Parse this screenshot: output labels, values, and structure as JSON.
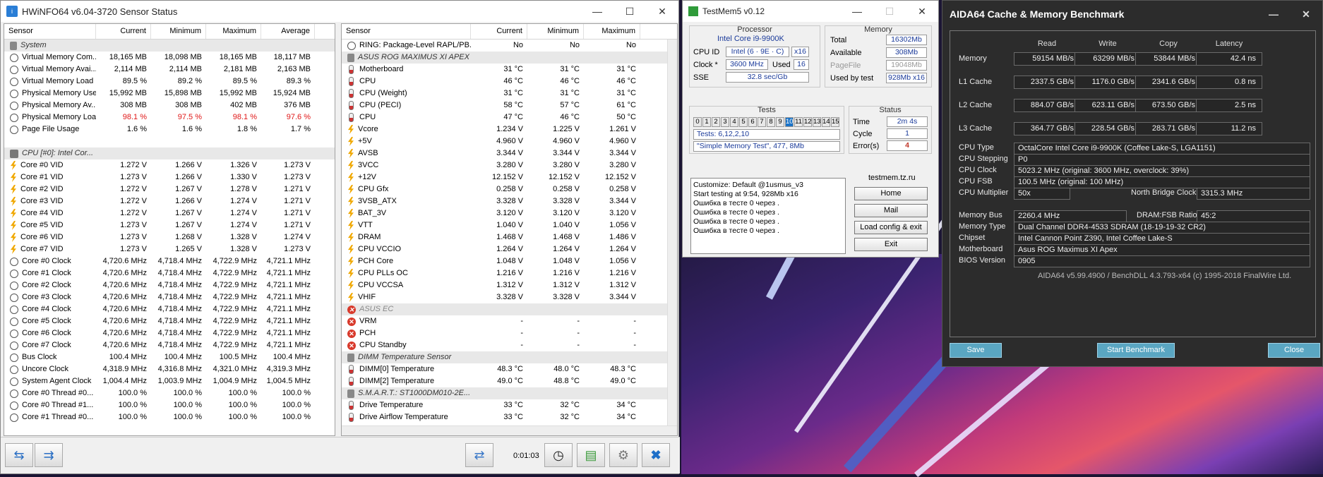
{
  "hwinfo": {
    "title": "HWiNFO64 v6.04-3720 Sensor Status",
    "left_headers": [
      "Sensor",
      "Current",
      "Minimum",
      "Maximum",
      "Average"
    ],
    "right_headers": [
      "Sensor",
      "Current",
      "Minimum",
      "Maximum"
    ],
    "left_rows": [
      {
        "t": "g",
        "n": "System"
      },
      {
        "t": "c",
        "n": "Virtual Memory Com...",
        "v": [
          "18,165 MB",
          "18,098 MB",
          "18,165 MB",
          "18,117 MB"
        ]
      },
      {
        "t": "c",
        "n": "Virtual Memory Avai...",
        "v": [
          "2,114 MB",
          "2,114 MB",
          "2,181 MB",
          "2,163 MB"
        ]
      },
      {
        "t": "c",
        "n": "Virtual Memory Load",
        "v": [
          "89.5 %",
          "89.2 %",
          "89.5 %",
          "89.3 %"
        ]
      },
      {
        "t": "c",
        "n": "Physical Memory Used",
        "v": [
          "15,992 MB",
          "15,898 MB",
          "15,992 MB",
          "15,924 MB"
        ]
      },
      {
        "t": "c",
        "n": "Physical Memory Av...",
        "v": [
          "308 MB",
          "308 MB",
          "402 MB",
          "376 MB"
        ]
      },
      {
        "t": "c",
        "n": "Physical Memory Load",
        "v": [
          "98.1 %",
          "97.5 %",
          "98.1 %",
          "97.6 %"
        ],
        "red": true
      },
      {
        "t": "c",
        "n": "Page File Usage",
        "v": [
          "1.6 %",
          "1.6 %",
          "1.8 %",
          "1.7 %"
        ]
      },
      {
        "t": "e"
      },
      {
        "t": "gc",
        "n": "CPU [#0]: Intel Cor..."
      },
      {
        "t": "b",
        "n": "Core #0 VID",
        "v": [
          "1.272 V",
          "1.266 V",
          "1.326 V",
          "1.273 V"
        ]
      },
      {
        "t": "b",
        "n": "Core #1 VID",
        "v": [
          "1.273 V",
          "1.266 V",
          "1.330 V",
          "1.273 V"
        ]
      },
      {
        "t": "b",
        "n": "Core #2 VID",
        "v": [
          "1.272 V",
          "1.267 V",
          "1.278 V",
          "1.271 V"
        ]
      },
      {
        "t": "b",
        "n": "Core #3 VID",
        "v": [
          "1.272 V",
          "1.266 V",
          "1.274 V",
          "1.271 V"
        ]
      },
      {
        "t": "b",
        "n": "Core #4 VID",
        "v": [
          "1.272 V",
          "1.267 V",
          "1.274 V",
          "1.271 V"
        ]
      },
      {
        "t": "b",
        "n": "Core #5 VID",
        "v": [
          "1.273 V",
          "1.267 V",
          "1.274 V",
          "1.271 V"
        ]
      },
      {
        "t": "b",
        "n": "Core #6 VID",
        "v": [
          "1.273 V",
          "1.268 V",
          "1.328 V",
          "1.274 V"
        ]
      },
      {
        "t": "b",
        "n": "Core #7 VID",
        "v": [
          "1.273 V",
          "1.265 V",
          "1.328 V",
          "1.273 V"
        ]
      },
      {
        "t": "c",
        "n": "Core #0 Clock",
        "v": [
          "4,720.6 MHz",
          "4,718.4 MHz",
          "4,722.9 MHz",
          "4,721.1 MHz"
        ]
      },
      {
        "t": "c",
        "n": "Core #1 Clock",
        "v": [
          "4,720.6 MHz",
          "4,718.4 MHz",
          "4,722.9 MHz",
          "4,721.1 MHz"
        ]
      },
      {
        "t": "c",
        "n": "Core #2 Clock",
        "v": [
          "4,720.6 MHz",
          "4,718.4 MHz",
          "4,722.9 MHz",
          "4,721.1 MHz"
        ]
      },
      {
        "t": "c",
        "n": "Core #3 Clock",
        "v": [
          "4,720.6 MHz",
          "4,718.4 MHz",
          "4,722.9 MHz",
          "4,721.1 MHz"
        ]
      },
      {
        "t": "c",
        "n": "Core #4 Clock",
        "v": [
          "4,720.6 MHz",
          "4,718.4 MHz",
          "4,722.9 MHz",
          "4,721.1 MHz"
        ]
      },
      {
        "t": "c",
        "n": "Core #5 Clock",
        "v": [
          "4,720.6 MHz",
          "4,718.4 MHz",
          "4,722.9 MHz",
          "4,721.1 MHz"
        ]
      },
      {
        "t": "c",
        "n": "Core #6 Clock",
        "v": [
          "4,720.6 MHz",
          "4,718.4 MHz",
          "4,722.9 MHz",
          "4,721.1 MHz"
        ]
      },
      {
        "t": "c",
        "n": "Core #7 Clock",
        "v": [
          "4,720.6 MHz",
          "4,718.4 MHz",
          "4,722.9 MHz",
          "4,721.1 MHz"
        ]
      },
      {
        "t": "c",
        "n": "Bus Clock",
        "v": [
          "100.4 MHz",
          "100.4 MHz",
          "100.5 MHz",
          "100.4 MHz"
        ]
      },
      {
        "t": "c",
        "n": "Uncore Clock",
        "v": [
          "4,318.9 MHz",
          "4,316.8 MHz",
          "4,321.0 MHz",
          "4,319.3 MHz"
        ]
      },
      {
        "t": "c",
        "n": "System Agent Clock",
        "v": [
          "1,004.4 MHz",
          "1,003.9 MHz",
          "1,004.9 MHz",
          "1,004.5 MHz"
        ]
      },
      {
        "t": "c",
        "n": "Core #0 Thread #0...",
        "v": [
          "100.0 %",
          "100.0 %",
          "100.0 %",
          "100.0 %"
        ]
      },
      {
        "t": "c",
        "n": "Core #0 Thread #1...",
        "v": [
          "100.0 %",
          "100.0 %",
          "100.0 %",
          "100.0 %"
        ]
      },
      {
        "t": "c",
        "n": "Core #1 Thread #0...",
        "v": [
          "100.0 %",
          "100.0 %",
          "100.0 %",
          "100.0 %"
        ]
      }
    ],
    "right_rows": [
      {
        "t": "c",
        "n": "RING: Package-Level RAPL/PB...",
        "v": [
          "No",
          "No",
          "No"
        ]
      },
      {
        "t": "g",
        "n": "ASUS ROG MAXIMUS XI APEX (..."
      },
      {
        "t": "tp",
        "n": "Motherboard",
        "v": [
          "31 °C",
          "31 °C",
          "31 °C"
        ]
      },
      {
        "t": "tp",
        "n": "CPU",
        "v": [
          "46 °C",
          "46 °C",
          "46 °C"
        ]
      },
      {
        "t": "tp",
        "n": "CPU (Weight)",
        "v": [
          "31 °C",
          "31 °C",
          "31 °C"
        ]
      },
      {
        "t": "tp",
        "n": "CPU (PECI)",
        "v": [
          "58 °C",
          "57 °C",
          "61 °C"
        ]
      },
      {
        "t": "tp",
        "n": "CPU",
        "v": [
          "47 °C",
          "46 °C",
          "50 °C"
        ]
      },
      {
        "t": "b",
        "n": "Vcore",
        "v": [
          "1.234 V",
          "1.225 V",
          "1.261 V"
        ]
      },
      {
        "t": "b",
        "n": "+5V",
        "v": [
          "4.960 V",
          "4.960 V",
          "4.960 V"
        ]
      },
      {
        "t": "b",
        "n": "AVSB",
        "v": [
          "3.344 V",
          "3.344 V",
          "3.344 V"
        ]
      },
      {
        "t": "b",
        "n": "3VCC",
        "v": [
          "3.280 V",
          "3.280 V",
          "3.280 V"
        ]
      },
      {
        "t": "b",
        "n": "+12V",
        "v": [
          "12.152 V",
          "12.152 V",
          "12.152 V"
        ]
      },
      {
        "t": "b",
        "n": "CPU Gfx",
        "v": [
          "0.258 V",
          "0.258 V",
          "0.258 V"
        ]
      },
      {
        "t": "b",
        "n": "3VSB_ATX",
        "v": [
          "3.328 V",
          "3.328 V",
          "3.344 V"
        ]
      },
      {
        "t": "b",
        "n": "BAT_3V",
        "v": [
          "3.120 V",
          "3.120 V",
          "3.120 V"
        ]
      },
      {
        "t": "b",
        "n": "VTT",
        "v": [
          "1.040 V",
          "1.040 V",
          "1.056 V"
        ]
      },
      {
        "t": "b",
        "n": "DRAM",
        "v": [
          "1.468 V",
          "1.468 V",
          "1.486 V"
        ]
      },
      {
        "t": "b",
        "n": "CPU VCCIO",
        "v": [
          "1.264 V",
          "1.264 V",
          "1.264 V"
        ]
      },
      {
        "t": "b",
        "n": "PCH Core",
        "v": [
          "1.048 V",
          "1.048 V",
          "1.056 V"
        ]
      },
      {
        "t": "b",
        "n": "CPU PLLs OC",
        "v": [
          "1.216 V",
          "1.216 V",
          "1.216 V"
        ]
      },
      {
        "t": "b",
        "n": "CPU VCCSA",
        "v": [
          "1.312 V",
          "1.312 V",
          "1.312 V"
        ]
      },
      {
        "t": "b",
        "n": "VHIF",
        "v": [
          "3.328 V",
          "3.328 V",
          "3.344 V"
        ]
      },
      {
        "t": "gx",
        "n": "ASUS EC"
      },
      {
        "t": "x",
        "n": "VRM",
        "v": [
          "-",
          "-",
          "-"
        ]
      },
      {
        "t": "x",
        "n": "PCH",
        "v": [
          "-",
          "-",
          "-"
        ]
      },
      {
        "t": "x",
        "n": "CPU Standby",
        "v": [
          "-",
          "-",
          "-"
        ]
      },
      {
        "t": "g",
        "n": "DIMM Temperature Sensor"
      },
      {
        "t": "tp",
        "n": "DIMM[0] Temperature",
        "v": [
          "48.3 °C",
          "48.0 °C",
          "48.3 °C"
        ]
      },
      {
        "t": "tp",
        "n": "DIMM[2] Temperature",
        "v": [
          "49.0 °C",
          "48.8 °C",
          "49.0 °C"
        ]
      },
      {
        "t": "g",
        "n": "S.M.A.R.T.: ST1000DM010-2E..."
      },
      {
        "t": "tp",
        "n": "Drive Temperature",
        "v": [
          "33 °C",
          "32 °C",
          "34 °C"
        ]
      },
      {
        "t": "tp",
        "n": "Drive Airflow Temperature",
        "v": [
          "33 °C",
          "32 °C",
          "34 °C"
        ]
      }
    ],
    "timer": "0:01:03"
  },
  "testmem": {
    "title": "TestMem5 v0.12",
    "processor_label": "Processor",
    "cpu_name": "Intel Core i9-9900K",
    "cpu_id_label": "CPU ID",
    "cpu_id": "Intel  (6 · 9E · C)",
    "cpu_threads": "x16",
    "clock_label": "Clock *",
    "clock": "3600 MHz",
    "used_label": "Used",
    "used": "16",
    "sse_label": "SSE",
    "sse": "32.8 sec/Gb",
    "memory_label": "Memory",
    "total_label": "Total",
    "total": "16302Mb",
    "available_label": "Available",
    "available": "308Mb",
    "pagefile_label": "PageFile",
    "pagefile": "19048Mb",
    "usedbytest_label": "Used by test",
    "usedbytest": "928Mb x16",
    "tests_label": "Tests",
    "test_cells": [
      "0",
      "1",
      "2",
      "3",
      "4",
      "5",
      "6",
      "7",
      "8",
      "9",
      "10",
      "11",
      "12",
      "13",
      "14",
      "15"
    ],
    "tests_line": "Tests: 6,12,2,10",
    "current_test": "\"Simple Memory Test\", 477, 8Mb",
    "status_label": "Status",
    "time_label": "Time",
    "time": "2m 4s",
    "cycle_label": "Cycle",
    "cycle": "1",
    "errors_label": "Error(s)",
    "errors": "4",
    "log": [
      "Customize: Default @1usmus_v3",
      "Start testing at 9:54, 928Mb x16",
      "Ошибка в тесте 0 через .",
      "Ошибка в тесте 0 через .",
      "Ошибка в тесте 0 через .",
      "Ошибка в тесте 0 через ."
    ],
    "site": "testmem.tz.ru",
    "btn_home": "Home",
    "btn_mail": "Mail",
    "btn_load": "Load config & exit",
    "btn_exit": "Exit"
  },
  "aida": {
    "title": "AIDA64 Cache & Memory Benchmark",
    "headers": [
      "Read",
      "Write",
      "Copy",
      "Latency"
    ],
    "rows": [
      {
        "label": "Memory",
        "v": [
          "59154 MB/s",
          "63299 MB/s",
          "53844 MB/s",
          "42.4 ns"
        ]
      },
      {
        "label": "L1 Cache",
        "v": [
          "2337.5 GB/s",
          "1176.0 GB/s",
          "2341.6 GB/s",
          "0.8 ns"
        ]
      },
      {
        "label": "L2 Cache",
        "v": [
          "884.07 GB/s",
          "623.11 GB/s",
          "673.50 GB/s",
          "2.5 ns"
        ]
      },
      {
        "label": "L3 Cache",
        "v": [
          "364.77 GB/s",
          "228.54 GB/s",
          "283.71 GB/s",
          "11.2 ns"
        ]
      }
    ],
    "info": [
      {
        "label": "CPU Type",
        "value": "OctalCore Intel Core i9-9900K  (Coffee Lake-S, LGA1151)"
      },
      {
        "label": "CPU Stepping",
        "value": "P0"
      },
      {
        "label": "CPU Clock",
        "value": "5023.2 MHz  (original: 3600 MHz, overclock: 39%)"
      },
      {
        "label": "CPU FSB",
        "value": "100.5 MHz  (original: 100 MHz)"
      },
      {
        "label": "CPU Multiplier",
        "value": "50x"
      }
    ],
    "nb_label": "North Bridge Clock",
    "nb_value": "3315.3 MHz",
    "membus_label": "Memory Bus",
    "membus": "2260.4 MHz",
    "ratio_label": "DRAM:FSB Ratio",
    "ratio": "45:2",
    "info2": [
      {
        "label": "Memory Type",
        "value": "Dual Channel DDR4-4533 SDRAM  (18-19-19-32 CR2)"
      },
      {
        "label": "Chipset",
        "value": "Intel Cannon Point Z390, Intel Coffee Lake-S"
      },
      {
        "label": "Motherboard",
        "value": "Asus ROG Maximus XI Apex"
      },
      {
        "label": "BIOS Version",
        "value": "0905"
      }
    ],
    "footer": "AIDA64 v5.99.4900 / BenchDLL 4.3.793-x64  (c) 1995-2018 FinalWire Ltd.",
    "btn_save": "Save",
    "btn_start": "Start Benchmark",
    "btn_close": "Close"
  }
}
